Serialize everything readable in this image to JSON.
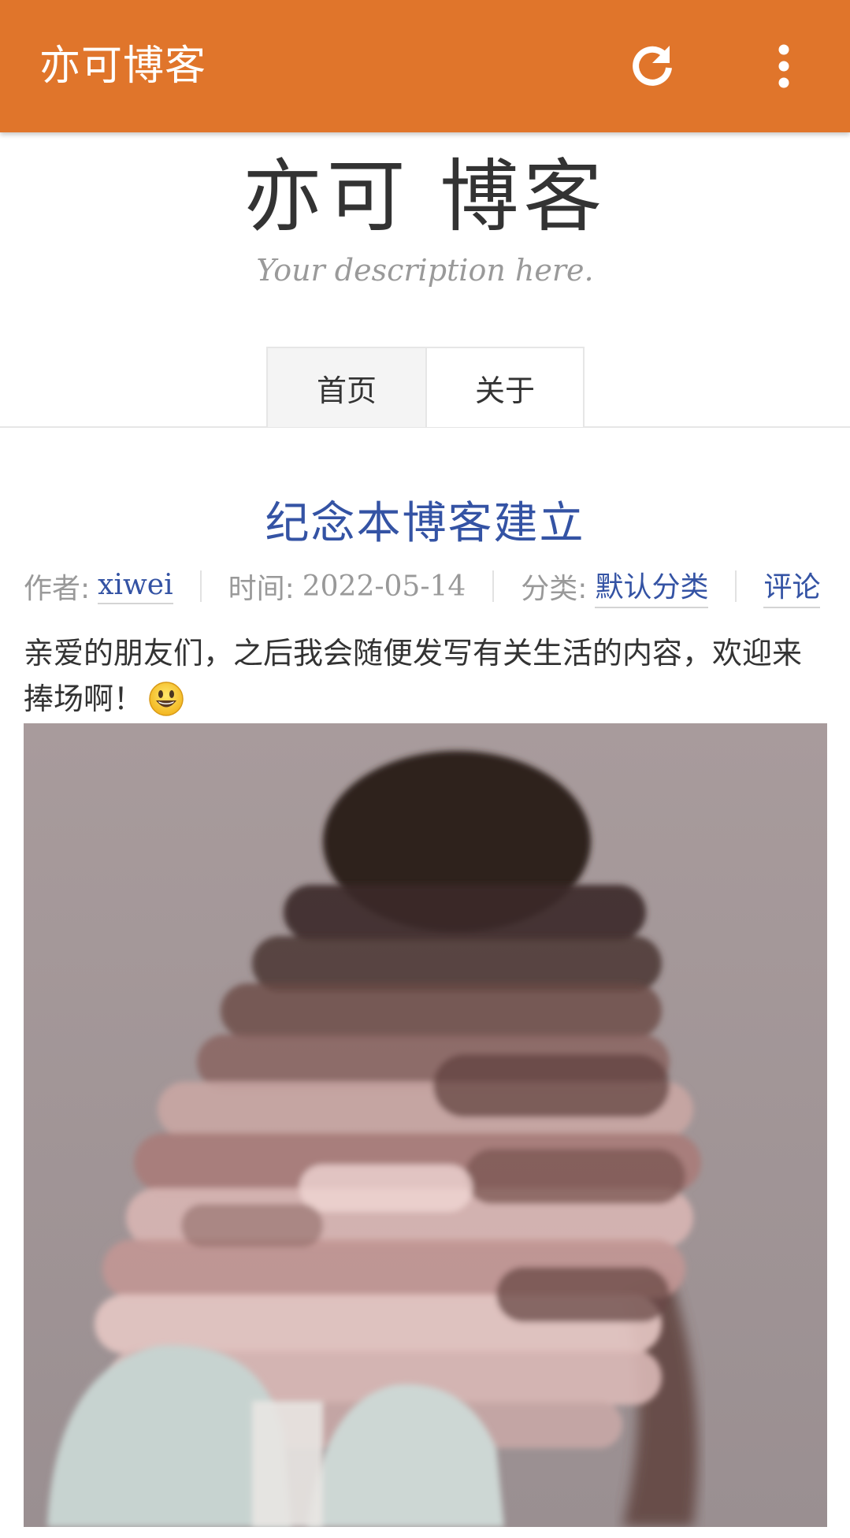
{
  "appbar": {
    "title": "亦可博客",
    "background": "#e0752b",
    "icons": [
      "refresh-icon",
      "more-vert-icon"
    ]
  },
  "header": {
    "site_title": "亦可 博客",
    "description": "Your description here."
  },
  "nav": {
    "items": [
      {
        "label": "首页",
        "active": true
      },
      {
        "label": "关于",
        "active": false
      }
    ]
  },
  "post": {
    "title": "纪念本博客建立",
    "title_color": "#3453a4",
    "meta": {
      "author_label": "作者:",
      "author": "xiwei",
      "date_label": "时间:",
      "date": "2022-05-14",
      "category_label": "分类:",
      "category": "默认分类",
      "comments": "评论"
    },
    "body_text": "亲爱的朋友们，之后我会随便发写有关生活的内容，欢迎来捧场啊！",
    "emoji": "smiley-emoji-icon"
  }
}
